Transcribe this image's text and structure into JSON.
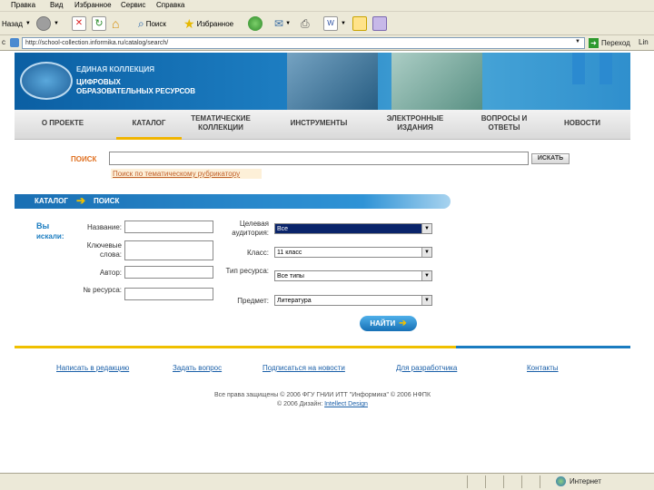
{
  "browser": {
    "menu": [
      "Правка",
      "Вид",
      "Избранное",
      "Сервис",
      "Справка"
    ],
    "toolbar": {
      "back": "Назад",
      "search": "Поиск",
      "favorites": "Избранное"
    },
    "address_label": "с",
    "address": "http://school-collection.informika.ru/catalog/search/",
    "go": "Переход",
    "links": "Lin",
    "status_zone": "Интернет"
  },
  "banner": {
    "line1": "ЕДИНАЯ КОЛЛЕКЦИЯ",
    "line2": "ЦИФРОВЫХ",
    "line3": "ОБРАЗОВАТЕЛЬНЫХ РЕСУРСОВ"
  },
  "nav": [
    {
      "label": "О ПРОЕКТЕ"
    },
    {
      "label": "КАТАЛОГ"
    },
    {
      "label": "ТЕМАТИЧЕСКИЕ КОЛЛЕКЦИИ"
    },
    {
      "label": "ИНСТРУМЕНТЫ"
    },
    {
      "label": "ЭЛЕКТРОННЫЕ ИЗДАНИЯ"
    },
    {
      "label": "ВОПРОСЫ И ОТВЕТЫ"
    },
    {
      "label": "НОВОСТИ"
    }
  ],
  "search": {
    "label": "ПОИСК",
    "value": "",
    "button": "ИСКАТЬ",
    "rubricator_link": "Поиск по тематическому рубрикатору"
  },
  "section": {
    "part1": "КАТАЛОГ",
    "part2": "ПОИСК"
  },
  "form": {
    "side_title_1": "Вы",
    "side_title_2": "искали:",
    "left": [
      {
        "label": "Название:"
      },
      {
        "label": "Ключевые слова:"
      },
      {
        "label": "Автор:"
      },
      {
        "label": "№ ресурса:"
      }
    ],
    "right": [
      {
        "label": "Целевая аудитория:",
        "value": "Все"
      },
      {
        "label": "Класс:",
        "value": "11 класс"
      },
      {
        "label": "Тип ресурса:",
        "value": "Все типы"
      },
      {
        "label": "Предмет:",
        "value": "Литература"
      }
    ],
    "submit": "НАЙТИ"
  },
  "footer": {
    "links": [
      "Написать в редакцию",
      "Задать вопрос",
      "Подписаться на новости",
      "Для разработчика",
      "Контакты"
    ],
    "copyright": "Все права защищены © 2006 ФГУ ГНИИ ИТТ \"Информика\" © 2006 НФПК",
    "design_prefix": "© 2006 Дизайн:",
    "design_link": "Intellect Design"
  },
  "colors": {
    "accent_blue": "#1a7cc0",
    "nav_underline": "#f0b400",
    "search_label": "#e07020",
    "footer_yellow": "#f0c000"
  }
}
